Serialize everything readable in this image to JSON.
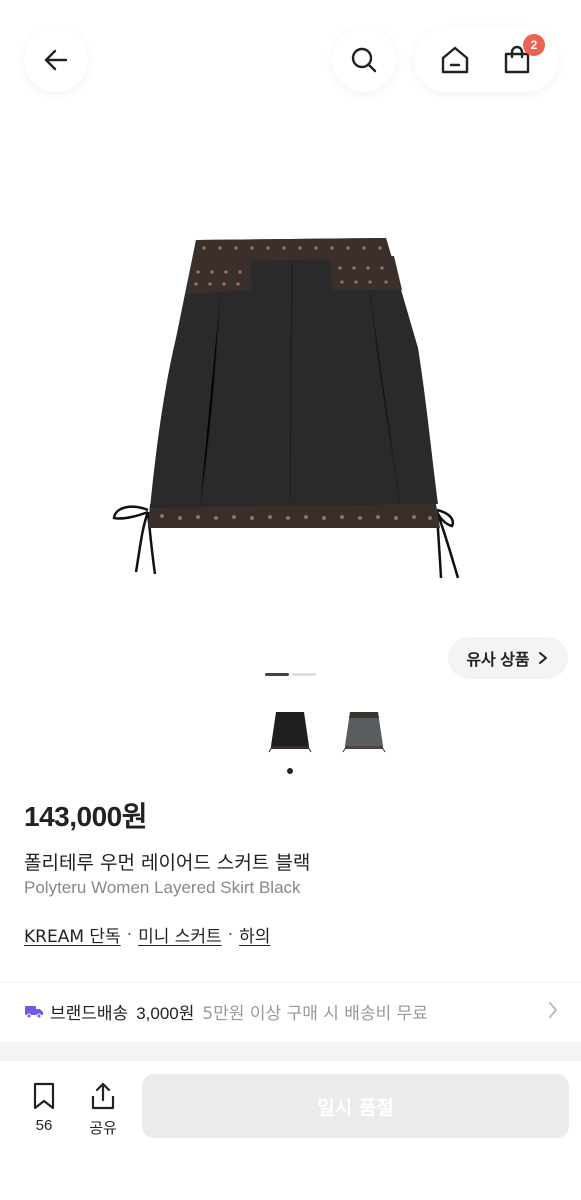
{
  "header": {
    "back_icon": "arrow-left-icon",
    "search_icon": "search-icon",
    "home_icon": "home-icon",
    "cart_icon": "shopping-bag-icon",
    "cart_count": "2",
    "badge_color": "#ef6253"
  },
  "gallery": {
    "similar_label": "유사 상품",
    "similar_chevron": "chevron-right-icon",
    "current_page": 1,
    "total_pages": 2,
    "thumbnails": [
      "black-skirt-thumbnail",
      "grey-skirt-thumbnail"
    ]
  },
  "product": {
    "price": "143,000원",
    "title_ko": "폴리테루 우먼 레이어드 스커트 블랙",
    "title_en": "Polyteru Women Layered Skirt Black",
    "categories": [
      "KREAM 단독",
      "미니 스커트",
      "하의"
    ],
    "separator": "·"
  },
  "shipping": {
    "icon": "delivery-truck-icon",
    "label": "브랜드배송",
    "price": "3,000원",
    "note": "5만원 이상 구매 시 배송비 무료",
    "icon_color": "#6b5ce7"
  },
  "bottom_bar": {
    "bookmark_count": "56",
    "share_label": "공유",
    "buy_label": "일시 품절"
  }
}
